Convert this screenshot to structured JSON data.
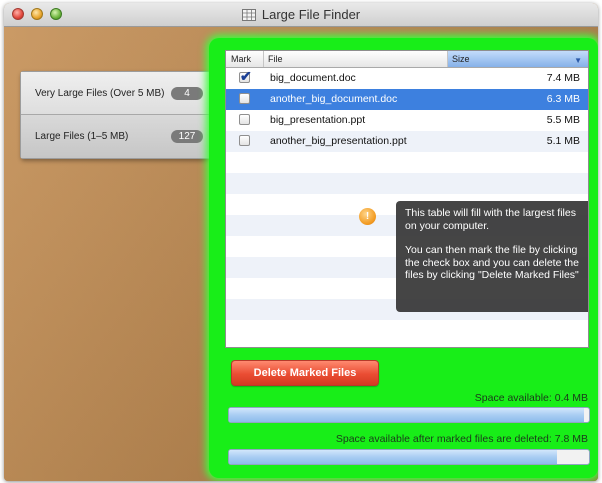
{
  "window": {
    "title": "Large File Finder",
    "app_icon": "ruler-grid-icon"
  },
  "sidebar": {
    "items": [
      {
        "label": "Very Large Files (Over 5 MB)",
        "count": "4"
      },
      {
        "label": "Large Files (1–5 MB)",
        "count": "127"
      }
    ]
  },
  "table": {
    "columns": {
      "mark": "Mark",
      "file": "File",
      "size": "Size"
    },
    "sort_indicator": "▼",
    "rows": [
      {
        "file": "big_document.doc",
        "size": "7.4 MB",
        "marked": true,
        "selected": false
      },
      {
        "file": "another_big_document.doc",
        "size": "6.3 MB",
        "marked": false,
        "selected": true
      },
      {
        "file": "big_presentation.ppt",
        "size": "5.5 MB",
        "marked": false,
        "selected": false
      },
      {
        "file": "another_big_presentation.ppt",
        "size": "5.1 MB",
        "marked": false,
        "selected": false
      }
    ]
  },
  "tooltip": {
    "icon": "!",
    "line1": "This table will fill with the largest files on your computer.",
    "line2": "You can then mark the file by clicking the check box and you can delete the files by clicking \"Delete Marked Files\""
  },
  "actions": {
    "delete_label": "Delete Marked Files"
  },
  "space": {
    "available_label": "Space available: 0.4 MB",
    "available_fill": 0.985,
    "after_label": "Space available after marked files are deleted: 7.8 MB",
    "after_fill": 0.91
  },
  "colors": {
    "highlight": "#18ee18",
    "selection": "#3d80df",
    "delete_button": "#ea4d33"
  }
}
